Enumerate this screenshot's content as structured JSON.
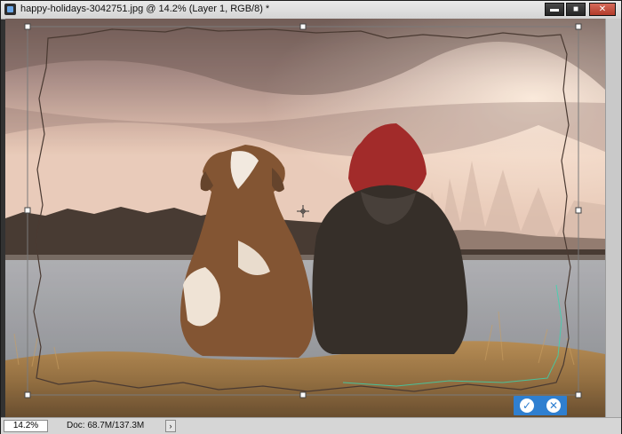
{
  "document": {
    "title": "happy-holidays-3042751.jpg @ 14.2% (Layer 1, RGB/8) *"
  },
  "window_controls": {
    "minimize": "▬",
    "maximize": "■",
    "close": "✕"
  },
  "status": {
    "zoom": "14.2%",
    "doc_info": "Doc: 68.7M/137.3M",
    "menu_arrow": "›"
  },
  "transform": {
    "commit": "✓",
    "cancel": "✕"
  },
  "icons": {
    "app": "photoshop-document-icon",
    "crosshair": "transform-center-icon"
  },
  "colors": {
    "title_bar": "#e1e1e1",
    "commit_bar": "#2f7fd0",
    "path_outline": "#4a3a32",
    "path_highlight": "#38d6b0"
  }
}
